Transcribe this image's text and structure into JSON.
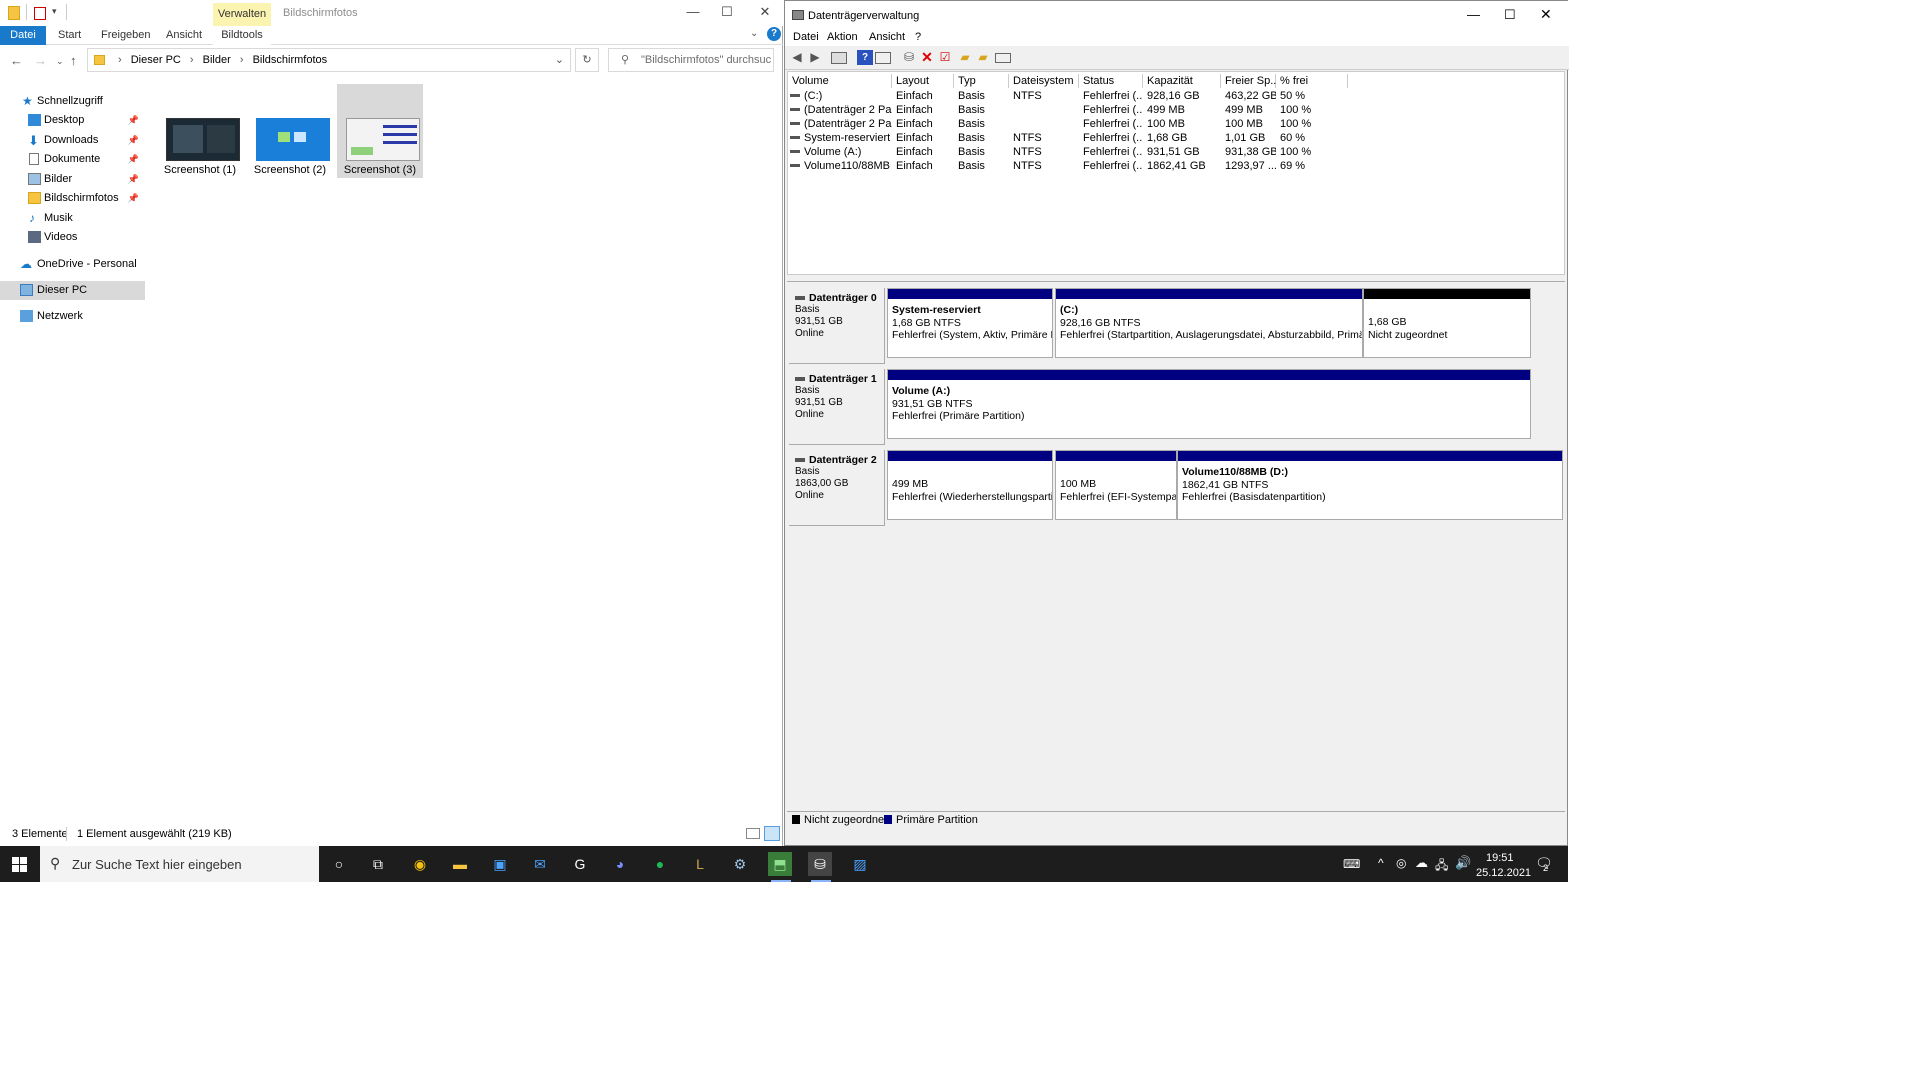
{
  "explorer": {
    "title": "Bildschirmfotos",
    "manage_tab": "Verwalten",
    "ribbon": {
      "datei": "Datei",
      "start": "Start",
      "freigeben": "Freigeben",
      "ansicht": "Ansicht",
      "bildtools": "Bildtools"
    },
    "breadcrumb": {
      "c1": "Dieser PC",
      "c2": "Bilder",
      "c3": "Bildschirmfotos"
    },
    "search_placeholder": "\"Bildschirmfotos\" durchsuc...",
    "nav": {
      "schnellzugriff": "Schnellzugriff",
      "desktop": "Desktop",
      "downloads": "Downloads",
      "dokumente": "Dokumente",
      "bilder": "Bilder",
      "bildschirmfotos": "Bildschirmfotos",
      "musik": "Musik",
      "videos": "Videos",
      "onedrive": "OneDrive - Personal",
      "dieser_pc": "Dieser PC",
      "netzwerk": "Netzwerk"
    },
    "files": [
      {
        "name": "Screenshot (1)"
      },
      {
        "name": "Screenshot (2)"
      },
      {
        "name": "Screenshot (3)"
      }
    ],
    "status_count": "3 Elemente",
    "status_selected": "1 Element ausgewählt (219 KB)"
  },
  "diskmgmt": {
    "title": "Datenträgerverwaltung",
    "menu": {
      "datei": "Datei",
      "aktion": "Aktion",
      "ansicht": "Ansicht",
      "help": "?"
    },
    "columns": {
      "volume": "Volume",
      "layout": "Layout",
      "typ": "Typ",
      "dateisystem": "Dateisystem",
      "status": "Status",
      "kapazitaet": "Kapazität",
      "freier": "Freier Sp...",
      "frei": "% frei"
    },
    "rows": [
      {
        "volume": "(C:)",
        "layout": "Einfach",
        "typ": "Basis",
        "fs": "NTFS",
        "status": "Fehlerfrei (...",
        "cap": "928,16 GB",
        "free": "463,22 GB",
        "pct": "50 %"
      },
      {
        "volume": "(Datenträger 2 Par...",
        "layout": "Einfach",
        "typ": "Basis",
        "fs": "",
        "status": "Fehlerfrei (...",
        "cap": "499 MB",
        "free": "499 MB",
        "pct": "100 %"
      },
      {
        "volume": "(Datenträger 2 Par...",
        "layout": "Einfach",
        "typ": "Basis",
        "fs": "",
        "status": "Fehlerfrei (...",
        "cap": "100 MB",
        "free": "100 MB",
        "pct": "100 %"
      },
      {
        "volume": "System-reserviert",
        "layout": "Einfach",
        "typ": "Basis",
        "fs": "NTFS",
        "status": "Fehlerfrei (...",
        "cap": "1,68 GB",
        "free": "1,01 GB",
        "pct": "60 %"
      },
      {
        "volume": "Volume (A:)",
        "layout": "Einfach",
        "typ": "Basis",
        "fs": "NTFS",
        "status": "Fehlerfrei (...",
        "cap": "931,51 GB",
        "free": "931,38 GB",
        "pct": "100 %"
      },
      {
        "volume": "Volume110/88MB ...",
        "layout": "Einfach",
        "typ": "Basis",
        "fs": "NTFS",
        "status": "Fehlerfrei (...",
        "cap": "1862,41 GB",
        "free": "1293,97 ...",
        "pct": "69 %"
      }
    ],
    "disks": [
      {
        "name": "Datenträger 0",
        "type": "Basis",
        "size": "931,51 GB",
        "state": "Online",
        "parts": [
          {
            "title": "System-reserviert",
            "size": "1,68 GB NTFS",
            "status": "Fehlerfrei (System, Aktiv, Primäre Pa"
          },
          {
            "title": "(C:)",
            "size": "928,16 GB NTFS",
            "status": "Fehlerfrei (Startpartition, Auslagerungsdatei, Absturzabbild, Primäre P"
          },
          {
            "title": "",
            "size": "1,68 GB",
            "status": "Nicht zugeordnet"
          }
        ]
      },
      {
        "name": "Datenträger 1",
        "type": "Basis",
        "size": "931,51 GB",
        "state": "Online",
        "parts": [
          {
            "title": "Volume  (A:)",
            "size": "931,51 GB NTFS",
            "status": "Fehlerfrei (Primäre Partition)"
          }
        ]
      },
      {
        "name": "Datenträger 2",
        "type": "Basis",
        "size": "1863,00 GB",
        "state": "Online",
        "parts": [
          {
            "title": "",
            "size": "499 MB",
            "status": "Fehlerfrei (Wiederherstellungspartiti"
          },
          {
            "title": "",
            "size": "100 MB",
            "status": "Fehlerfrei (EFI-Systempart"
          },
          {
            "title": "Volume110/88MB  (D:)",
            "size": "1862,41 GB NTFS",
            "status": "Fehlerfrei (Basisdatenpartition)"
          }
        ]
      }
    ],
    "legend": {
      "unallocated": "Nicht zugeordnet",
      "primary": "Primäre Partition"
    }
  },
  "taskbar": {
    "search_placeholder": "Zur Suche Text hier eingeben",
    "time": "19:51",
    "date": "25.12.2021",
    "notif_count": "2"
  }
}
